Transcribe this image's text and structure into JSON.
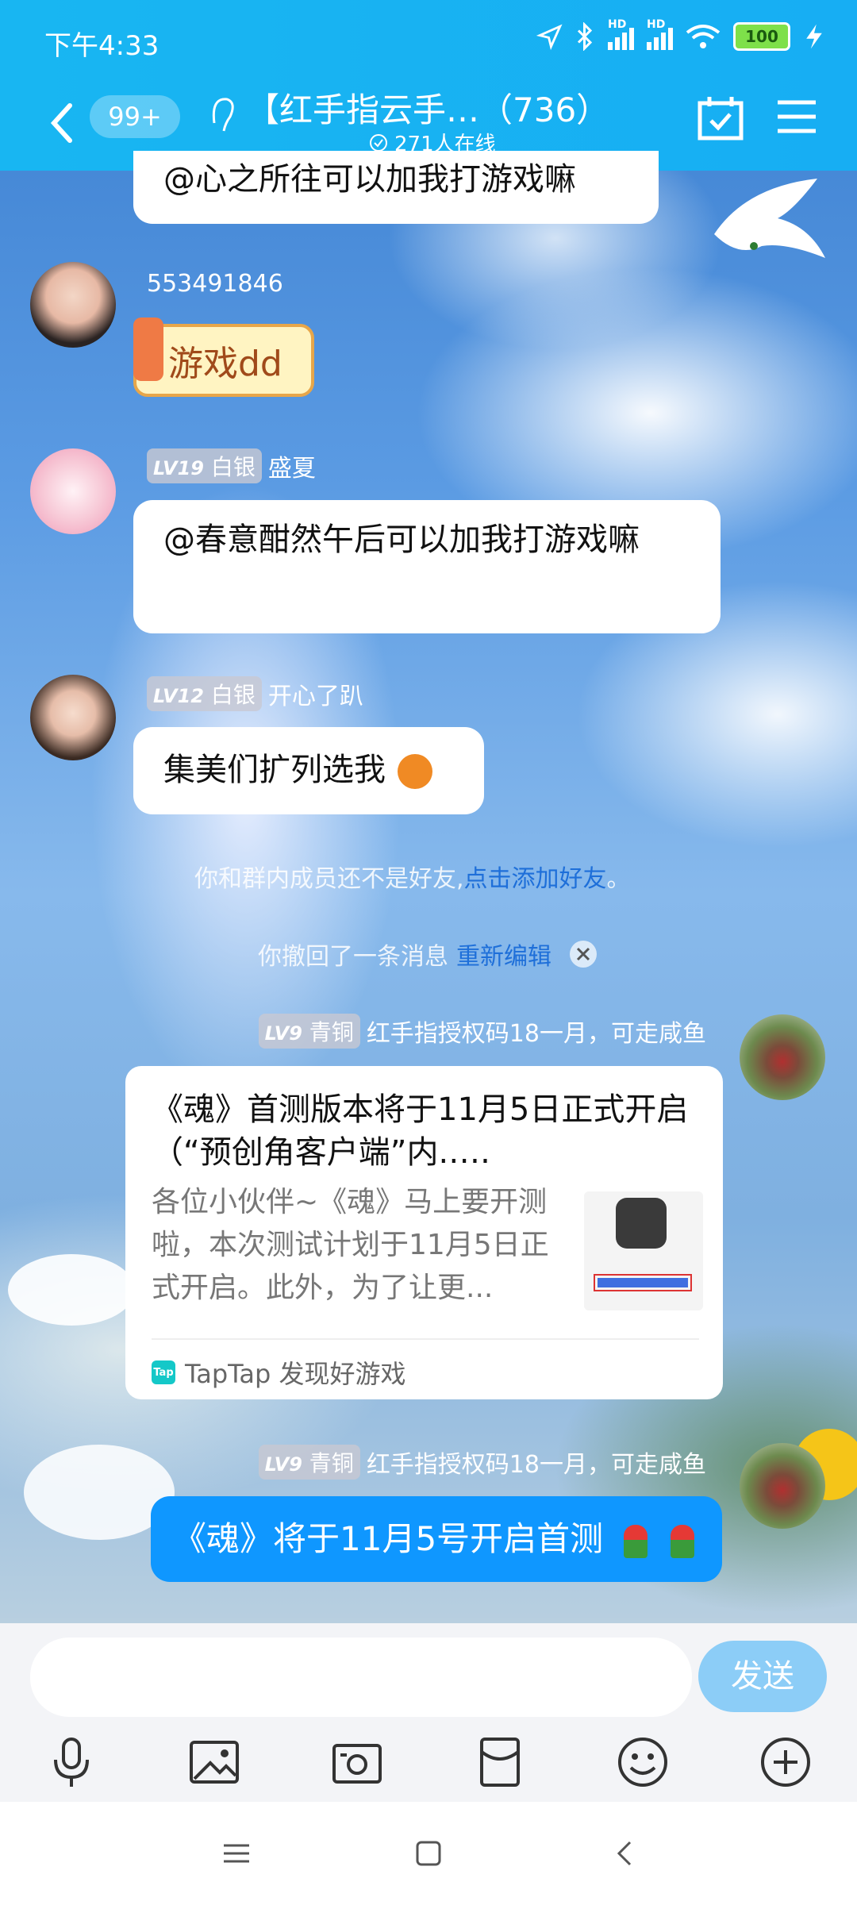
{
  "status_bar": {
    "time": "下午4:33",
    "battery": "100",
    "network_1": "HD",
    "network_2": "HD"
  },
  "header": {
    "unread_badge": "99+",
    "group_title": "【红手指云手…（736）",
    "online_count": "271人在线"
  },
  "messages": [
    {
      "type": "text_partial",
      "text": "@心之所往可以加我打游戏嘛"
    },
    {
      "type": "sticker",
      "sender": "553491846",
      "sticker_text": "游戏dd"
    },
    {
      "type": "text",
      "level": "LV19",
      "rank": "白银",
      "sender": "盛夏",
      "text": "@春意酣然午后可以加我打游戏嘛"
    },
    {
      "type": "text",
      "level": "LV12",
      "rank": "白银",
      "sender": "开心了趴",
      "text": "集美们扩列选我"
    }
  ],
  "system": {
    "not_friend_text": "你和群内成员还不是好友,",
    "add_friend_link": "点击添加好友",
    "add_friend_suffix": "。",
    "recall_text": "你撤回了一条消息",
    "reedit_link": "重新编辑"
  },
  "self_messages": [
    {
      "level": "LV9",
      "rank": "青铜",
      "sender": "红手指授权码18一月，可走咸鱼",
      "card_title": "《魂》首测版本将于11月5日正式开启（“预创角客户端”内.….",
      "card_desc": "各位小伙伴~《魂》马上要开测啦，本次测试计划于11月5日正式开启。此外，为了让更...",
      "card_source": "TapTap 发现好游戏",
      "source_icon_text": "Tap"
    },
    {
      "level": "LV9",
      "rank": "青铜",
      "sender": "红手指授权码18一月，可走咸鱼",
      "text": "《魂》将于11月5号开启首测"
    }
  ],
  "input": {
    "placeholder": "",
    "send_label": "发送"
  },
  "toolbar": {
    "icons": [
      "microphone-icon",
      "image-icon",
      "camera-icon",
      "red-packet-icon",
      "emoji-icon",
      "plus-icon"
    ]
  },
  "colors": {
    "header_blue": "#18b6f2",
    "self_bubble": "#0f97ff",
    "send_button": "#8ccdf7",
    "link_blue": "#1e6fd9"
  }
}
